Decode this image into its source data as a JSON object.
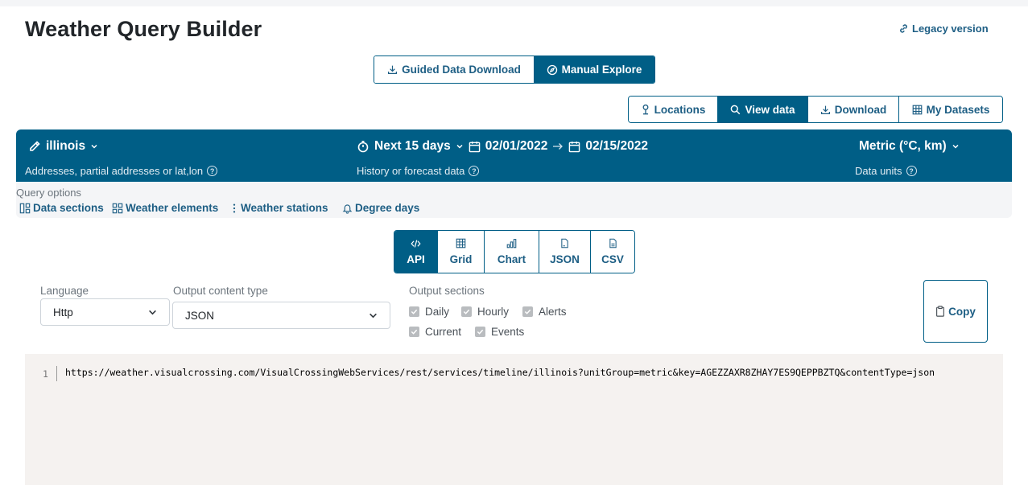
{
  "header": {
    "title": "Weather Query Builder",
    "legacy_link": "Legacy version"
  },
  "mode_tabs": [
    {
      "label": "Guided Data Download",
      "icon": "download-icon",
      "active": false
    },
    {
      "label": "Manual Explore",
      "icon": "compass-icon",
      "active": true
    }
  ],
  "view_tabs": [
    {
      "label": "Locations",
      "icon": "pin-icon",
      "active": false
    },
    {
      "label": "View data",
      "icon": "search-icon",
      "active": true
    },
    {
      "label": "Download",
      "icon": "download-icon",
      "active": false
    },
    {
      "label": "My Datasets",
      "icon": "grid-icon",
      "active": false
    }
  ],
  "query_bar": {
    "location": "illinois",
    "location_help": "Addresses, partial addresses or lat,lon",
    "period": "Next 15 days",
    "start_date": "02/01/2022",
    "end_date": "02/15/2022",
    "period_help": "History or forecast data",
    "units": "Metric (°C, km)",
    "units_help": "Data units",
    "background_color": "#005e86"
  },
  "query_options": {
    "label": "Query options",
    "items": [
      {
        "label": "Data sections",
        "icon": "sections-icon"
      },
      {
        "label": "Weather elements",
        "icon": "elements-icon"
      },
      {
        "label": "Weather stations",
        "icon": "vertical-dots-icon"
      },
      {
        "label": "Degree days",
        "icon": "bell-icon"
      }
    ]
  },
  "output_tabs": [
    {
      "label": "API",
      "icon": "code-icon",
      "active": true
    },
    {
      "label": "Grid",
      "icon": "table-icon",
      "active": false
    },
    {
      "label": "Chart",
      "icon": "bar-chart-icon",
      "active": false
    },
    {
      "label": "JSON",
      "icon": "file-icon",
      "active": false
    },
    {
      "label": "CSV",
      "icon": "file-icon",
      "active": false
    }
  ],
  "settings": {
    "language_label": "Language",
    "language_value": "Http",
    "content_type_label": "Output content type",
    "content_type_value": "JSON",
    "sections_label": "Output sections",
    "sections": [
      {
        "label": "Daily",
        "checked": true
      },
      {
        "label": "Hourly",
        "checked": true
      },
      {
        "label": "Alerts",
        "checked": true
      },
      {
        "label": "Current",
        "checked": true
      },
      {
        "label": "Events",
        "checked": true
      }
    ],
    "copy_label": "Copy"
  },
  "code": {
    "line_number": "1",
    "text": "https://weather.visualcrossing.com/VisualCrossingWebServices/rest/services/timeline/illinois?unitGroup=metric&key=AGEZZAXR8ZHAY7ES9QEPPBZTQ&contentType=json"
  }
}
